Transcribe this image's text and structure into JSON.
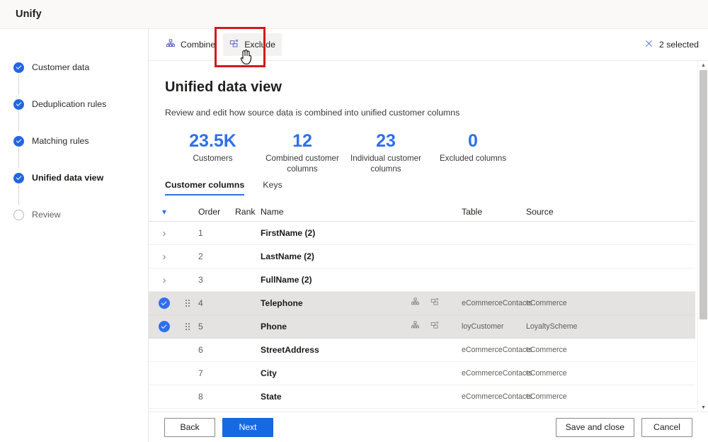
{
  "app": {
    "title": "Unify"
  },
  "colors": {
    "accent": "#2f6fed",
    "primary_button": "#1668e3",
    "highlight_annotation": "#d01b1b",
    "selected_row": "#e4e3e2"
  },
  "sidebar": {
    "items": [
      {
        "label": "Customer data",
        "state": "done"
      },
      {
        "label": "Deduplication rules",
        "state": "done"
      },
      {
        "label": "Matching rules",
        "state": "done"
      },
      {
        "label": "Unified data view",
        "state": "done",
        "current": true
      },
      {
        "label": "Review",
        "state": "todo"
      }
    ]
  },
  "toolbar": {
    "combine_label": "Combine",
    "exclude_label": "Exclude",
    "combine_icon": "combine-icon",
    "exclude_icon": "exclude-icon",
    "selection_label": "2 selected",
    "clear_selection_icon": "close-x-icon"
  },
  "main": {
    "title": "Unified data view",
    "subtitle": "Review and edit how source data is combined into unified customer columns",
    "stats": [
      {
        "value": "23.5K",
        "caption": "Customers"
      },
      {
        "value": "12",
        "caption": "Combined customer columns"
      },
      {
        "value": "23",
        "caption": "Individual customer columns"
      },
      {
        "value": "0",
        "caption": "Excluded columns"
      }
    ],
    "tabs": [
      {
        "label": "Customer columns",
        "active": true
      },
      {
        "label": "Keys",
        "active": false
      }
    ],
    "table": {
      "headers": {
        "expand": "chevron-down",
        "order": "Order",
        "rank": "Rank",
        "name": "Name",
        "table": "Table",
        "source": "Source"
      },
      "rows": [
        {
          "selected": false,
          "expandable": true,
          "drag": false,
          "order": "1",
          "rank": "",
          "name": "FirstName (2)",
          "actions": false,
          "table": "",
          "source": ""
        },
        {
          "selected": false,
          "expandable": true,
          "drag": false,
          "order": "2",
          "rank": "",
          "name": "LastName (2)",
          "actions": false,
          "table": "",
          "source": ""
        },
        {
          "selected": false,
          "expandable": true,
          "drag": false,
          "order": "3",
          "rank": "",
          "name": "FullName (2)",
          "actions": false,
          "table": "",
          "source": ""
        },
        {
          "selected": true,
          "expandable": false,
          "drag": true,
          "order": "4",
          "rank": "",
          "name": "Telephone",
          "actions": true,
          "table": "eCommerceContacts",
          "source": "eCommerce"
        },
        {
          "selected": true,
          "expandable": false,
          "drag": true,
          "order": "5",
          "rank": "",
          "name": "Phone",
          "actions": true,
          "table": "loyCustomer",
          "source": "LoyaltyScheme"
        },
        {
          "selected": false,
          "expandable": false,
          "drag": false,
          "order": "6",
          "rank": "",
          "name": "StreetAddress",
          "actions": false,
          "table": "eCommerceContacts",
          "source": "eCommerce"
        },
        {
          "selected": false,
          "expandable": false,
          "drag": false,
          "order": "7",
          "rank": "",
          "name": "City",
          "actions": false,
          "table": "eCommerceContacts",
          "source": "eCommerce"
        },
        {
          "selected": false,
          "expandable": false,
          "drag": false,
          "order": "8",
          "rank": "",
          "name": "State",
          "actions": false,
          "table": "eCommerceContacts",
          "source": "eCommerce"
        }
      ]
    }
  },
  "footer": {
    "back_label": "Back",
    "next_label": "Next",
    "save_close_label": "Save and close",
    "cancel_label": "Cancel"
  }
}
